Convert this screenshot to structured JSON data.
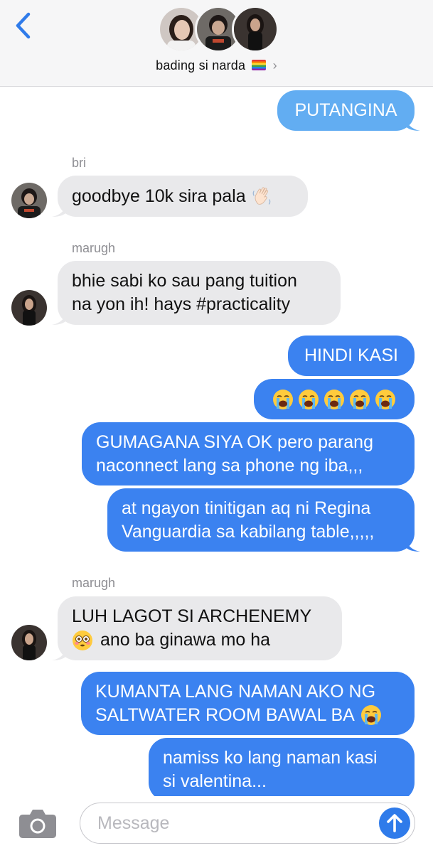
{
  "header": {
    "group_name": "bading si narda",
    "flag_icon": "rainbow-flag-icon",
    "chevron": "›",
    "back_icon": "chevron-left-icon"
  },
  "messages": [
    {
      "type": "outgoing",
      "text": "PUTANGINA"
    },
    {
      "type": "sender",
      "name": "bri"
    },
    {
      "type": "incoming",
      "text": "goodbye 10k sira pala",
      "emoji": "waving-hand-emoji"
    },
    {
      "type": "sender",
      "name": "marugh"
    },
    {
      "type": "incoming",
      "lines": [
        "bhie sabi ko sau pang tuition",
        "na yon ih! hays #practicality"
      ]
    },
    {
      "type": "outgoing",
      "text": "HINDI KASI"
    },
    {
      "type": "outgoing",
      "emoji": "loudly-crying-face-emoji",
      "count": 5
    },
    {
      "type": "outgoing",
      "lines": [
        "GUMAGANA SIYA OK pero parang",
        "naconnect lang sa phone ng iba,,,"
      ]
    },
    {
      "type": "outgoing",
      "lines": [
        "at ngayon tinitigan aq ni Regina",
        "Vanguardia sa kabilang table,,,,,"
      ]
    },
    {
      "type": "sender",
      "name": "marugh"
    },
    {
      "type": "incoming",
      "lines": [
        "LUH LAGOT SI ARCHENEMY",
        "ano ba ginawa mo ha"
      ],
      "emoji": "flushed-face-emoji"
    },
    {
      "type": "outgoing",
      "lines": [
        "KUMANTA LANG NAMAN AKO NG",
        "SALTWATER ROOM BAWAL BA"
      ],
      "emoji": "loudly-crying-face-emoji"
    },
    {
      "type": "outgoing",
      "lines": [
        "namiss ko lang naman kasi",
        "si valentina..."
      ]
    }
  ],
  "input": {
    "placeholder": "Message",
    "camera_icon": "camera-icon",
    "send_icon": "arrow-up-icon"
  },
  "colors": {
    "outgoing_bubble": "#3b82f0",
    "outgoing_bubble_light": "#62adf2",
    "incoming_bubble": "#e9e9eb",
    "accent": "#2f7bea",
    "header_bg": "#f6f6f7"
  }
}
